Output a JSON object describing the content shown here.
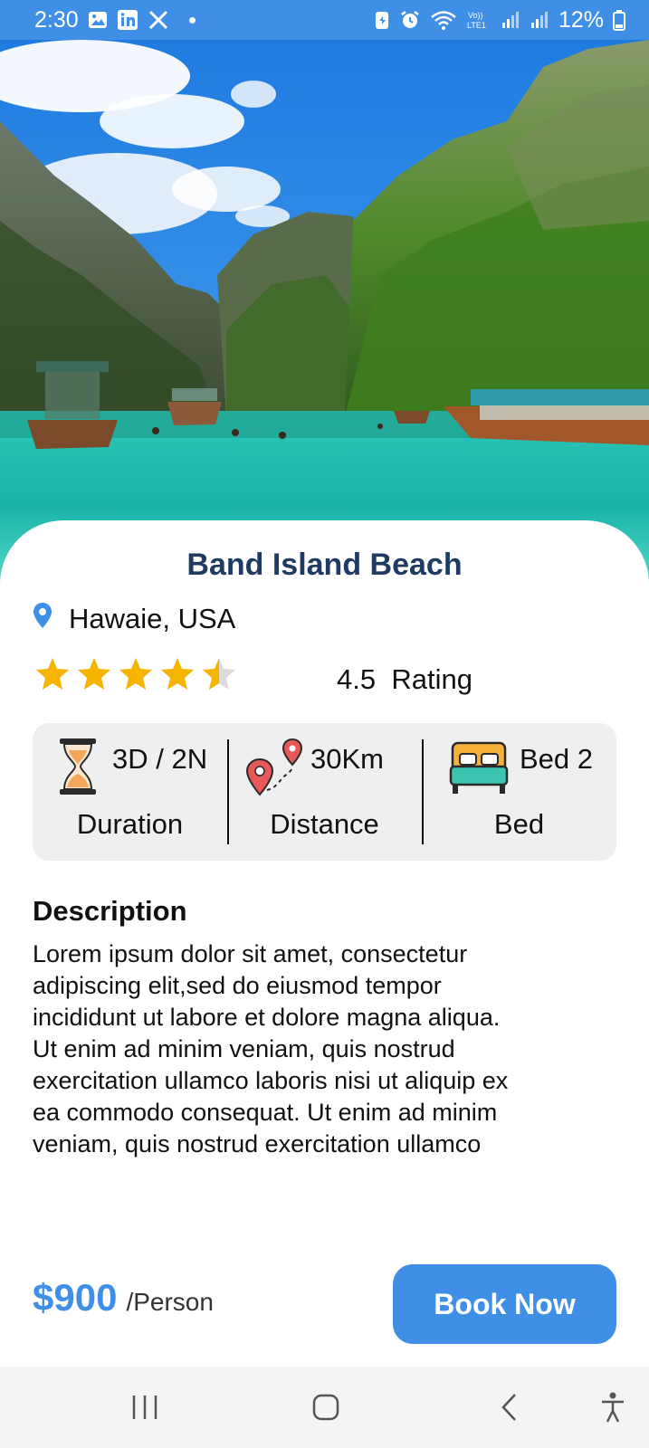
{
  "status_bar": {
    "time": "2:30",
    "battery": "12%",
    "background": "#3f8fe6"
  },
  "hero": {
    "image_alt": "tropical lagoon with cliffs and longtail boats"
  },
  "destination": {
    "title": "Band Island Beach",
    "location": "Hawaie, USA",
    "rating_stars": 4.5,
    "rating_value": "4.5",
    "rating_label": "Rating"
  },
  "info": [
    {
      "value": "3D / 2N",
      "label": "Duration",
      "icon": "hourglass-icon"
    },
    {
      "value": "30Km",
      "label": "Distance",
      "icon": "route-pin-icon"
    },
    {
      "value": "Bed 2",
      "label": "Bed",
      "icon": "bed-icon"
    }
  ],
  "description": {
    "heading": "Description",
    "lines": [
      "Lorem ipsum dolor sit amet, consectetur",
      "adipiscing  elit,sed do eiusmod tempor",
      "incididunt ut labore et  dolore magna aliqua.",
      "Ut enim ad minim veniam, quis  nostrud",
      "exercitation ullamco laboris nisi ut aliquip  ex",
      "ea commodo consequat. Ut enim ad minim",
      "veniam, quis nostrud exercitation ullamco"
    ]
  },
  "booking": {
    "price": "$900",
    "unit": "/Person",
    "button": "Book Now"
  },
  "colors": {
    "accent": "#3f8fe6",
    "title": "#1f3b63",
    "star": "#f5b400",
    "info_bg": "#efefef"
  }
}
